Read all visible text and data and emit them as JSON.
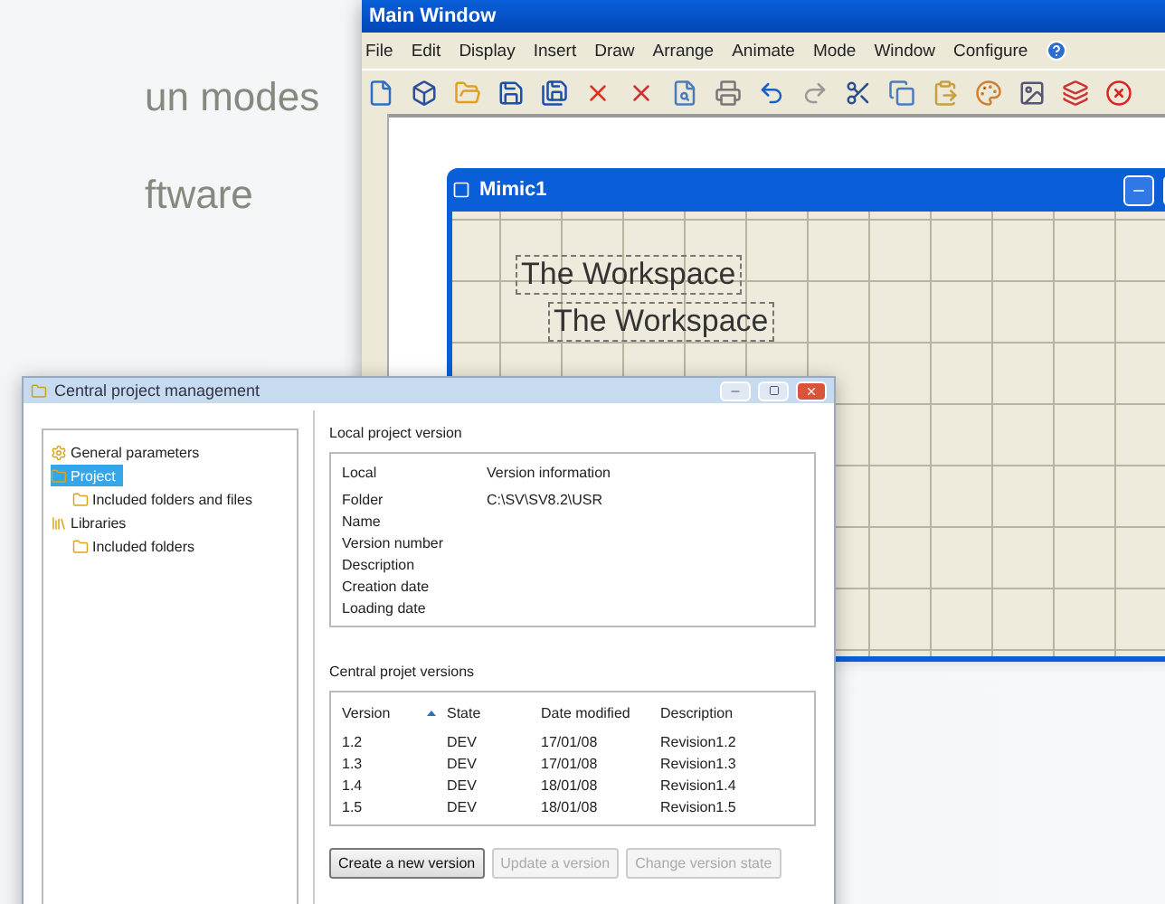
{
  "slide_text": [
    "un modes",
    "ftware"
  ],
  "main_window": {
    "title": "Main Window",
    "menu": [
      "File",
      "Edit",
      "Display",
      "Insert",
      "Draw",
      "Arrange",
      "Animate",
      "Mode",
      "Window",
      "Configure"
    ],
    "mimic": {
      "title": "Mimic1",
      "texts": [
        "The Workspace",
        "The Workspace"
      ]
    }
  },
  "dialog": {
    "title": "Central project management",
    "tree": [
      {
        "label": "General parameters",
        "selected": false
      },
      {
        "label": "Project",
        "selected": true,
        "children": [
          {
            "label": "Included folders and files",
            "selected": false
          }
        ]
      },
      {
        "label": "Libraries",
        "selected": false,
        "children": [
          {
            "label": "Included folders",
            "selected": false
          }
        ]
      }
    ],
    "local": {
      "title": "Local project version",
      "columns": [
        "Local",
        "Version information"
      ],
      "rows": [
        [
          "Folder",
          "C:\\SV\\SV8.2\\USR"
        ],
        [
          "Name",
          ""
        ],
        [
          "Version number",
          ""
        ],
        [
          "Description",
          ""
        ],
        [
          "Creation date",
          ""
        ],
        [
          "Loading date",
          ""
        ]
      ]
    },
    "central": {
      "title": "Central projet versions",
      "columns": [
        "Version",
        "State",
        "Date modified",
        "Description"
      ],
      "rows": [
        [
          "1.2",
          "DEV",
          "17/01/08",
          "Revision1.2"
        ],
        [
          "1.3",
          "DEV",
          "17/01/08",
          "Revision1.3"
        ],
        [
          "1.4",
          "DEV",
          "18/01/08",
          "Revision1.4"
        ],
        [
          "1.5",
          "DEV",
          "18/01/08",
          "Revision1.5"
        ]
      ]
    },
    "buttons": [
      {
        "label": "Create a new version",
        "disabled": false
      },
      {
        "label": "Update a version",
        "disabled": true
      },
      {
        "label": "Change version state",
        "disabled": true
      }
    ]
  }
}
